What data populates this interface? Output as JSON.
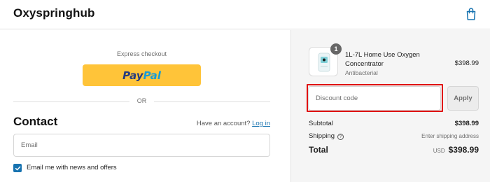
{
  "header": {
    "store_name": "Oxyspringhub"
  },
  "express": {
    "label": "Express checkout",
    "paypal_part1": "Pay",
    "paypal_part2": "Pal",
    "separator": "OR"
  },
  "contact": {
    "heading": "Contact",
    "account_prompt": "Have an account?",
    "login_label": "Log in",
    "email_placeholder": "Email",
    "newsletter_label": "Email me with news and offers",
    "newsletter_checked": true
  },
  "cart": {
    "items": [
      {
        "name": "1L-7L Home Use Oxygen Concentrator",
        "variant": "Antibacterial",
        "quantity": "1",
        "price": "$398.99"
      }
    ]
  },
  "discount": {
    "placeholder": "Discount code",
    "apply_label": "Apply"
  },
  "summary": {
    "subtotal_label": "Subtotal",
    "subtotal_value": "$398.99",
    "shipping_label": "Shipping",
    "shipping_value": "Enter shipping address",
    "total_label": "Total",
    "currency": "USD",
    "total_value": "$398.99"
  },
  "colors": {
    "paypal_yellow": "#ffc439",
    "link_blue": "#1773b0",
    "highlight_red": "#e01010"
  }
}
